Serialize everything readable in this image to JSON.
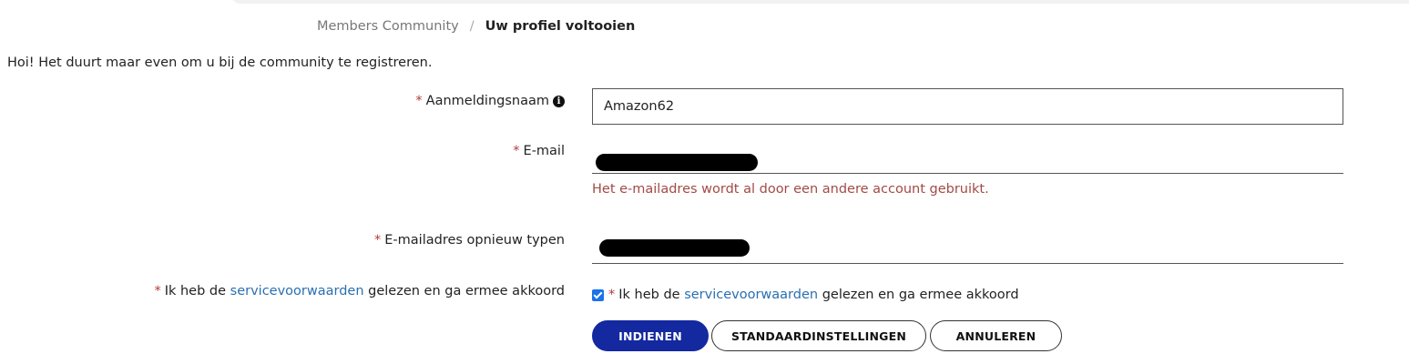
{
  "breadcrumb": {
    "parent": "Members Community",
    "separator": "/",
    "current": "Uw profiel voltooien"
  },
  "intro": "Hoi! Het duurt maar even om u bij de community te registreren.",
  "form": {
    "required_mark": "*",
    "username": {
      "label": "Aanmeldingsnaam",
      "value": "Amazon62",
      "info_icon": "info-icon"
    },
    "email": {
      "label": "E-mail",
      "error": "Het e-mailadres wordt al door een andere account gebruikt."
    },
    "email_confirm": {
      "label": "E-mailadres opnieuw typen"
    },
    "terms": {
      "prefix": "Ik heb de",
      "link": "servicevoorwaarden",
      "suffix": "gelezen en ga ermee akkoord",
      "checked": true
    }
  },
  "buttons": {
    "submit": "INDIENEN",
    "defaults": "STANDAARDINSTELLINGEN",
    "cancel": "ANNULEREN"
  },
  "colors": {
    "primary": "#1428a0",
    "required": "#b33a3a",
    "error": "#a14b45",
    "link": "#2a6fb0"
  }
}
